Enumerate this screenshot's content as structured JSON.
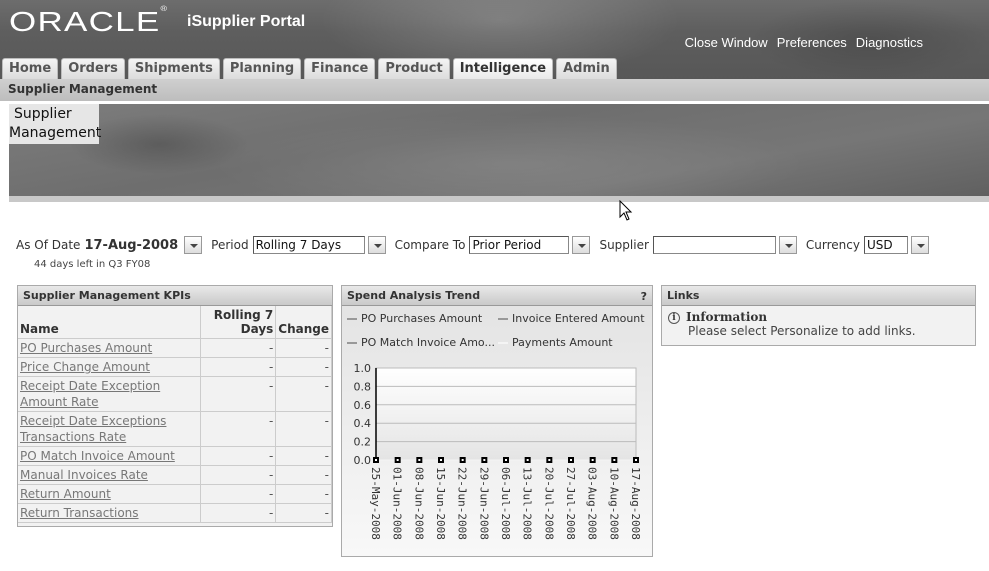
{
  "header": {
    "logo": "ORACLE",
    "app_title": "iSupplier Portal",
    "global_links": [
      "Close Window",
      "Preferences",
      "Diagnostics"
    ]
  },
  "tabs": [
    {
      "label": "Home",
      "active": false
    },
    {
      "label": "Orders",
      "active": false
    },
    {
      "label": "Shipments",
      "active": false
    },
    {
      "label": "Planning",
      "active": false
    },
    {
      "label": "Finance",
      "active": false
    },
    {
      "label": "Product",
      "active": false
    },
    {
      "label": "Intelligence",
      "active": true
    },
    {
      "label": "Admin",
      "active": false
    }
  ],
  "subtab": "Supplier Management",
  "banner": {
    "title_line1": "Supplier",
    "title_line2": "Management"
  },
  "params": {
    "as_of_date_label": "As Of Date",
    "as_of_date_value": "17-Aug-2008",
    "days_left": "44 days left in Q3 FY08",
    "period_label": "Period",
    "period_value": "Rolling 7 Days",
    "compare_label": "Compare To",
    "compare_value": "Prior Period",
    "supplier_label": "Supplier",
    "supplier_value": "",
    "currency_label": "Currency",
    "currency_value": "USD"
  },
  "kpi": {
    "title": "Supplier Management KPIs",
    "columns": [
      "Name",
      "Rolling 7 Days",
      "Change"
    ],
    "rows": [
      {
        "name": "PO Purchases Amount",
        "value": "-",
        "change": "-"
      },
      {
        "name": "Price Change Amount",
        "value": "-",
        "change": "-"
      },
      {
        "name": "Receipt Date Exception Amount Rate",
        "value": "-",
        "change": "-"
      },
      {
        "name": "Receipt Date Exceptions Transactions Rate",
        "value": "-",
        "change": "-"
      },
      {
        "name": "PO Match Invoice Amount",
        "value": "-",
        "change": "-"
      },
      {
        "name": "Manual Invoices Rate",
        "value": "-",
        "change": "-"
      },
      {
        "name": "Return Amount",
        "value": "-",
        "change": "-"
      },
      {
        "name": "Return Transactions",
        "value": "-",
        "change": "-"
      }
    ]
  },
  "spend": {
    "title": "Spend Analysis Trend",
    "help": "?"
  },
  "chart_data": {
    "type": "line",
    "title": "Spend Analysis Trend",
    "xlabel": "",
    "ylabel": "",
    "x": [
      "25-May-2008",
      "01-Jun-2008",
      "08-Jun-2008",
      "15-Jun-2008",
      "22-Jun-2008",
      "29-Jun-2008",
      "06-Jul-2008",
      "13-Jul-2008",
      "20-Jul-2008",
      "27-Jul-2008",
      "03-Aug-2008",
      "10-Aug-2008",
      "17-Aug-2008"
    ],
    "yticks": [
      "0.0",
      "0.2",
      "0.4",
      "0.6",
      "0.8",
      "1.0"
    ],
    "ylim": [
      0,
      1.0
    ],
    "grid": true,
    "legend_position": "top",
    "series": [
      {
        "name": "PO Purchases Amount",
        "color": "#999999",
        "values": [
          0,
          0,
          0,
          0,
          0,
          0,
          0,
          0,
          0,
          0,
          0,
          0,
          0
        ]
      },
      {
        "name": "Invoice Entered Amount",
        "color": "#999999",
        "values": [
          0,
          0,
          0,
          0,
          0,
          0,
          0,
          0,
          0,
          0,
          0,
          0,
          0
        ]
      },
      {
        "name": "PO Match Invoice Amo...",
        "color": "#999999",
        "values": [
          0,
          0,
          0,
          0,
          0,
          0,
          0,
          0,
          0,
          0,
          0,
          0,
          0
        ]
      },
      {
        "name": "Payments Amount",
        "color": "#f4f4f4",
        "values": [
          0,
          0,
          0,
          0,
          0,
          0,
          0,
          0,
          0,
          0,
          0,
          0,
          0
        ]
      }
    ]
  },
  "links": {
    "title": "Links",
    "info_heading": "Information",
    "info_text": "Please select Personalize to add links."
  }
}
